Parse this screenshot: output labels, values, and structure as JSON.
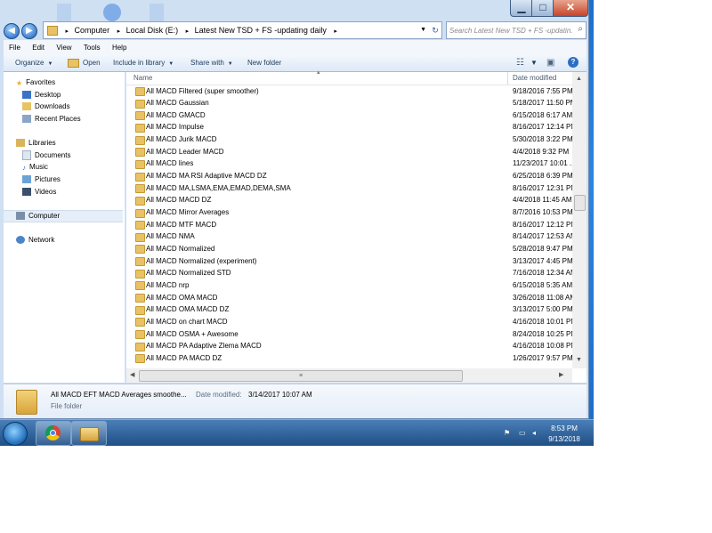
{
  "window_buttons": {
    "minimize": "▁",
    "maximize": "□",
    "close": "✕"
  },
  "nav_buttons": {
    "back": "◀",
    "forward": "▶"
  },
  "address": {
    "segments": [
      "Computer",
      "Local Disk (E:)",
      "Latest New TSD + FS -updating daily"
    ],
    "separator": "▸",
    "refresh": "↻"
  },
  "search": {
    "placeholder": "Search Latest New TSD + FS -updatin...",
    "icon": "search-icon"
  },
  "menubar": [
    "File",
    "Edit",
    "View",
    "Tools",
    "Help"
  ],
  "toolbar": {
    "organize": "Organize",
    "open": "Open",
    "include_in_library": "Include in library",
    "share_with": "Share with",
    "new_folder": "New folder"
  },
  "navpane": {
    "favorites": "Favorites",
    "desktop": "Desktop",
    "downloads": "Downloads",
    "recent_places": "Recent Places",
    "libraries": "Libraries",
    "documents": "Documents",
    "music": "Music",
    "pictures": "Pictures",
    "videos": "Videos",
    "computer": "Computer",
    "network": "Network"
  },
  "columns": {
    "name": "Name",
    "date_modified": "Date modified"
  },
  "files": [
    {
      "name": "All  MACD Filtered (super smoother)",
      "date": "9/18/2016 7:55 PM"
    },
    {
      "name": "All  MACD Gaussian",
      "date": "5/18/2017 11:50 PM"
    },
    {
      "name": "All  MACD GMACD",
      "date": "6/15/2018 6:17 AM"
    },
    {
      "name": "All  MACD Impulse",
      "date": "8/16/2017 12:14 PM"
    },
    {
      "name": "All  MACD Jurik MACD",
      "date": "5/30/2018 3:22 PM"
    },
    {
      "name": "All  MACD Leader MACD",
      "date": "4/4/2018 9:32 PM"
    },
    {
      "name": "All  MACD lines",
      "date": "11/23/2017 10:01 ..."
    },
    {
      "name": "All  MACD MA RSI Adaptive MACD DZ",
      "date": "6/25/2018 6:39 PM"
    },
    {
      "name": "All  MACD MA,LSMA,EMA,EMAD,DEMA,SMA",
      "date": "8/16/2017 12:31 PM"
    },
    {
      "name": "All  MACD MACD DZ",
      "date": "4/4/2018 11:45 AM"
    },
    {
      "name": "All  MACD Mirror Averages",
      "date": "8/7/2016 10:53 PM"
    },
    {
      "name": "All  MACD MTF MACD",
      "date": "8/16/2017 12:12 PM"
    },
    {
      "name": "All  MACD NMA",
      "date": "8/14/2017 12:53 AM"
    },
    {
      "name": "All  MACD Normalized",
      "date": "5/28/2018 9:47 PM"
    },
    {
      "name": "All  MACD Normalized (experiment)",
      "date": "3/13/2017 4:45 PM"
    },
    {
      "name": "All  MACD Normalized STD",
      "date": "7/16/2018 12:34 AM"
    },
    {
      "name": "All  MACD nrp",
      "date": "6/15/2018 5:35 AM"
    },
    {
      "name": "All  MACD OMA MACD",
      "date": "3/26/2018 11:08 AM"
    },
    {
      "name": "All  MACD OMA MACD DZ",
      "date": "3/13/2017 5:00 PM"
    },
    {
      "name": "All  MACD on chart MACD",
      "date": "4/16/2018 10:01 PM"
    },
    {
      "name": "All  MACD OSMA + Awesome",
      "date": "8/24/2018 10:25 PM"
    },
    {
      "name": "All  MACD PA Adaptive Zlema MACD",
      "date": "4/16/2018 10:08 PM"
    },
    {
      "name": "All  MACD PA MACD DZ",
      "date": "1/26/2017 9:57 PM"
    }
  ],
  "details": {
    "name": "All   MACD EFT MACD Averages smoothe...",
    "modified_label": "Date modified:",
    "modified_value": "3/14/2017 10:07 AM",
    "type": "File folder"
  },
  "taskbar": {
    "time": "8:53 PM",
    "date": "9/13/2018",
    "tray_icons": [
      "flag-icon",
      "network-icon",
      "speaker-icon"
    ]
  },
  "colors": {
    "accent": "#1c6fc9",
    "folder": "#e8c264",
    "selection": "#e5eef9"
  }
}
